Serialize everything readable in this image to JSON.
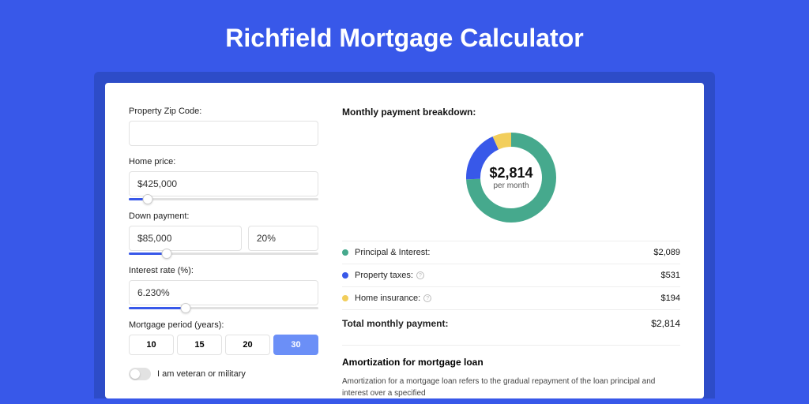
{
  "title": "Richfield Mortgage Calculator",
  "form": {
    "zip_label": "Property Zip Code:",
    "zip_value": "",
    "home_price_label": "Home price:",
    "home_price_value": "$425,000",
    "home_price_slider_pct": 10,
    "down_payment_label": "Down payment:",
    "down_payment_value": "$85,000",
    "down_payment_pct_value": "20%",
    "down_payment_slider_pct": 20,
    "interest_label": "Interest rate (%):",
    "interest_value": "6.230%",
    "interest_slider_pct": 30,
    "period_label": "Mortgage period (years):",
    "periods": [
      "10",
      "15",
      "20",
      "30"
    ],
    "period_active_index": 3,
    "veteran_label": "I am veteran or military"
  },
  "breakdown": {
    "title": "Monthly payment breakdown:",
    "center_value": "$2,814",
    "center_sub": "per month",
    "items": [
      {
        "label": "Principal & Interest:",
        "value": "$2,089",
        "color": "#46A98D",
        "has_info": false,
        "pct": 74.2
      },
      {
        "label": "Property taxes:",
        "value": "$531",
        "color": "#3858E9",
        "has_info": true,
        "pct": 18.9
      },
      {
        "label": "Home insurance:",
        "value": "$194",
        "color": "#F2CE5B",
        "has_info": true,
        "pct": 6.9
      }
    ],
    "total_label": "Total monthly payment:",
    "total_value": "$2,814"
  },
  "amortization": {
    "title": "Amortization for mortgage loan",
    "body": "Amortization for a mortgage loan refers to the gradual repayment of the loan principal and interest over a specified"
  },
  "chart_data": {
    "type": "pie",
    "title": "Monthly payment breakdown",
    "categories": [
      "Principal & Interest",
      "Property taxes",
      "Home insurance"
    ],
    "values": [
      2089,
      531,
      194
    ],
    "total": 2814,
    "colors": [
      "#46A98D",
      "#3858E9",
      "#F2CE5B"
    ]
  }
}
